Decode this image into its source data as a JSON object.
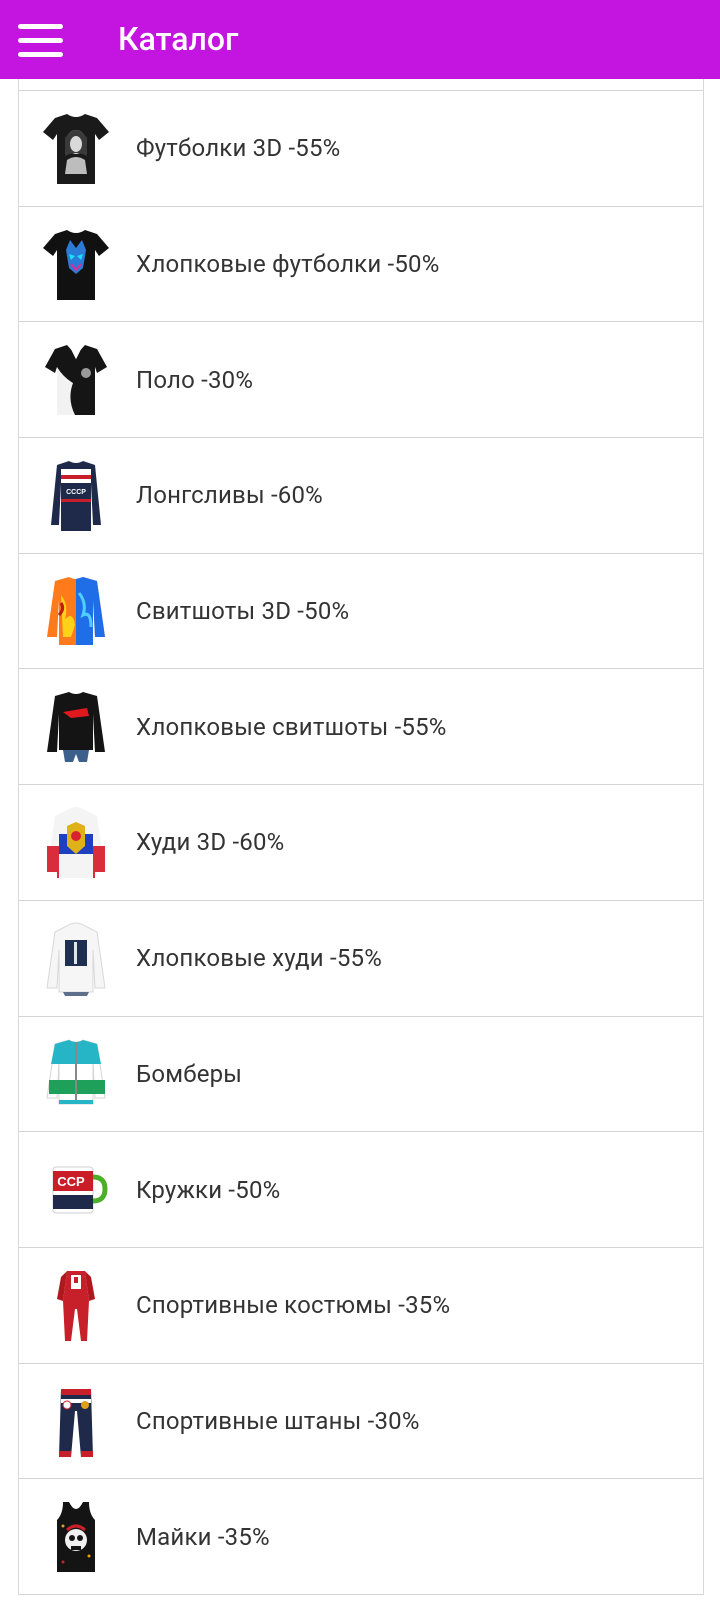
{
  "appbar": {
    "title": "Каталог",
    "menu_icon": "hamburger-menu-icon",
    "color": "#c314e0"
  },
  "catalog": {
    "items": [
      {
        "label": "Футболки 3D -55%",
        "icon": "tshirt-3d-thumbnail"
      },
      {
        "label": "Хлопковые футболки -50%",
        "icon": "cotton-tshirt-thumbnail"
      },
      {
        "label": "Поло -30%",
        "icon": "polo-thumbnail"
      },
      {
        "label": "Лонгсливы -60%",
        "icon": "longsleeve-thumbnail"
      },
      {
        "label": "Свитшоты 3D -50%",
        "icon": "sweatshirt-3d-thumbnail"
      },
      {
        "label": "Хлопковые свитшоты -55%",
        "icon": "cotton-sweatshirt-thumbnail"
      },
      {
        "label": "Худи 3D -60%",
        "icon": "hoodie-3d-thumbnail"
      },
      {
        "label": "Хлопковые худи -55%",
        "icon": "cotton-hoodie-thumbnail"
      },
      {
        "label": "Бомберы",
        "icon": "bomber-thumbnail"
      },
      {
        "label": "Кружки -50%",
        "icon": "mug-thumbnail"
      },
      {
        "label": "Спортивные костюмы -35%",
        "icon": "tracksuit-thumbnail"
      },
      {
        "label": "Спортивные штаны -30%",
        "icon": "sweatpants-thumbnail"
      },
      {
        "label": "Майки -35%",
        "icon": "tank-top-thumbnail"
      }
    ]
  }
}
